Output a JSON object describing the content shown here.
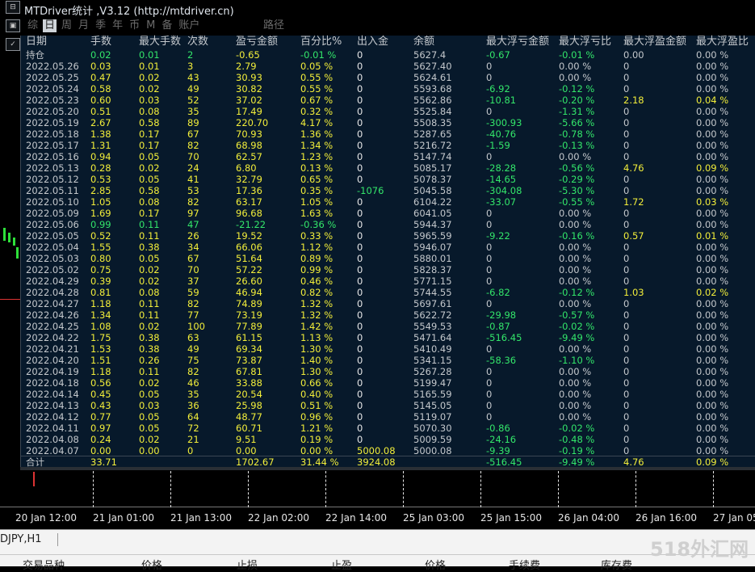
{
  "window": {
    "title": "MTDriver统计 ,V3.12 (http://mtdriver.cn)"
  },
  "tabs": [
    {
      "label": "综",
      "active": false
    },
    {
      "label": "日",
      "active": true
    },
    {
      "label": "周",
      "active": false
    },
    {
      "label": "月",
      "active": false
    },
    {
      "label": "季",
      "active": false
    },
    {
      "label": "年",
      "active": false
    },
    {
      "label": "币",
      "active": false
    },
    {
      "label": "M",
      "active": false
    },
    {
      "label": "备",
      "active": false
    },
    {
      "label": "账户",
      "active": false
    }
  ],
  "path_tab": "路径",
  "left_icons": [
    "⊟",
    "✓"
  ],
  "table": {
    "headers": [
      "日期",
      "手数",
      "最大手数",
      "次数",
      "盈亏金额",
      "百分比%",
      "出入金",
      "余额",
      "最大浮亏金额",
      "最大浮亏比",
      "最大浮盈金额",
      "最大浮盈比"
    ],
    "holding": {
      "date": "持仓",
      "lots": "0.02",
      "maxlots": "0.01",
      "count": "2",
      "pnl": "-0.65",
      "pct": "-0.01 %",
      "flow": "0",
      "balance": "5627.4",
      "floss": "-0.67",
      "flossp": "-0.01 %",
      "fgain": "0.00",
      "fgainp": "0.00 %"
    },
    "rows": [
      [
        "2022.05.26",
        "0.03",
        "0.01",
        "3",
        "2.79",
        "0.05 %",
        "0",
        "5627.40",
        "0",
        "0.00 %",
        "0",
        "0.00 %"
      ],
      [
        "2022.05.25",
        "0.47",
        "0.02",
        "43",
        "30.93",
        "0.55 %",
        "0",
        "5624.61",
        "0",
        "0.00 %",
        "0",
        "0.00 %"
      ],
      [
        "2022.05.24",
        "0.58",
        "0.02",
        "49",
        "30.82",
        "0.55 %",
        "0",
        "5593.68",
        "-6.92",
        "-0.12 %",
        "0",
        "0.00 %"
      ],
      [
        "2022.05.23",
        "0.60",
        "0.03",
        "52",
        "37.02",
        "0.67 %",
        "0",
        "5562.86",
        "-10.81",
        "-0.20 %",
        "2.18",
        "0.04 %"
      ],
      [
        "2022.05.20",
        "0.51",
        "0.08",
        "35",
        "17.49",
        "0.32 %",
        "0",
        "5525.84",
        "0",
        "-1.31 %",
        "0",
        "0.00 %"
      ],
      [
        "2022.05.19",
        "2.67",
        "0.58",
        "89",
        "220.70",
        "4.17 %",
        "0",
        "5508.35",
        "-300.93",
        "-5.66 %",
        "0",
        "0.00 %"
      ],
      [
        "2022.05.18",
        "1.38",
        "0.17",
        "67",
        "70.93",
        "1.36 %",
        "0",
        "5287.65",
        "-40.76",
        "-0.78 %",
        "0",
        "0.00 %"
      ],
      [
        "2022.05.17",
        "1.31",
        "0.17",
        "82",
        "68.98",
        "1.34 %",
        "0",
        "5216.72",
        "-1.59",
        "-0.13 %",
        "0",
        "0.00 %"
      ],
      [
        "2022.05.16",
        "0.94",
        "0.05",
        "70",
        "62.57",
        "1.23 %",
        "0",
        "5147.74",
        "0",
        "0.00 %",
        "0",
        "0.00 %"
      ],
      [
        "2022.05.13",
        "0.28",
        "0.02",
        "24",
        "6.80",
        "0.13 %",
        "0",
        "5085.17",
        "-28.28",
        "-0.56 %",
        "4.76",
        "0.09 %"
      ],
      [
        "2022.05.12",
        "0.53",
        "0.05",
        "41",
        "32.79",
        "0.65 %",
        "0",
        "5078.37",
        "-14.65",
        "-0.29 %",
        "0",
        "0.00 %"
      ],
      [
        "2022.05.11",
        "2.85",
        "0.58",
        "53",
        "17.36",
        "0.35 %",
        "-1076",
        "5045.58",
        "-304.08",
        "-5.30 %",
        "0",
        "0.00 %"
      ],
      [
        "2022.05.10",
        "1.05",
        "0.08",
        "82",
        "63.17",
        "1.05 %",
        "0",
        "6104.22",
        "-33.07",
        "-0.55 %",
        "1.72",
        "0.03 %"
      ],
      [
        "2022.05.09",
        "1.69",
        "0.17",
        "97",
        "96.68",
        "1.63 %",
        "0",
        "6041.05",
        "0",
        "0.00 %",
        "0",
        "0.00 %"
      ],
      [
        "2022.05.06",
        "0.99",
        "0.11",
        "47",
        "-21.22",
        "-0.36 %",
        "0",
        "5944.37",
        "0",
        "0.00 %",
        "0",
        "0.00 %"
      ],
      [
        "2022.05.05",
        "0.52",
        "0.11",
        "26",
        "19.52",
        "0.33 %",
        "0",
        "5965.59",
        "-9.22",
        "-0.16 %",
        "0.57",
        "0.01 %"
      ],
      [
        "2022.05.04",
        "1.55",
        "0.38",
        "34",
        "66.06",
        "1.12 %",
        "0",
        "5946.07",
        "0",
        "0.00 %",
        "0",
        "0.00 %"
      ],
      [
        "2022.05.03",
        "0.80",
        "0.05",
        "67",
        "51.64",
        "0.89 %",
        "0",
        "5880.01",
        "0",
        "0.00 %",
        "0",
        "0.00 %"
      ],
      [
        "2022.05.02",
        "0.75",
        "0.02",
        "70",
        "57.22",
        "0.99 %",
        "0",
        "5828.37",
        "0",
        "0.00 %",
        "0",
        "0.00 %"
      ],
      [
        "2022.04.29",
        "0.39",
        "0.02",
        "37",
        "26.60",
        "0.46 %",
        "0",
        "5771.15",
        "0",
        "0.00 %",
        "0",
        "0.00 %"
      ],
      [
        "2022.04.28",
        "0.81",
        "0.08",
        "59",
        "46.94",
        "0.82 %",
        "0",
        "5744.55",
        "-6.82",
        "-0.12 %",
        "1.03",
        "0.02 %"
      ],
      [
        "2022.04.27",
        "1.18",
        "0.11",
        "82",
        "74.89",
        "1.32 %",
        "0",
        "5697.61",
        "0",
        "0.00 %",
        "0",
        "0.00 %"
      ],
      [
        "2022.04.26",
        "1.34",
        "0.11",
        "77",
        "73.19",
        "1.32 %",
        "0",
        "5622.72",
        "-29.98",
        "-0.57 %",
        "0",
        "0.00 %"
      ],
      [
        "2022.04.25",
        "1.08",
        "0.02",
        "100",
        "77.89",
        "1.42 %",
        "0",
        "5549.53",
        "-0.87",
        "-0.02 %",
        "0",
        "0.00 %"
      ],
      [
        "2022.04.22",
        "1.75",
        "0.38",
        "63",
        "61.15",
        "1.13 %",
        "0",
        "5471.64",
        "-516.45",
        "-9.49 %",
        "0",
        "0.00 %"
      ],
      [
        "2022.04.21",
        "1.53",
        "0.38",
        "49",
        "69.34",
        "1.30 %",
        "0",
        "5410.49",
        "0",
        "0.00 %",
        "0",
        "0.00 %"
      ],
      [
        "2022.04.20",
        "1.51",
        "0.26",
        "75",
        "73.87",
        "1.40 %",
        "0",
        "5341.15",
        "-58.36",
        "-1.10 %",
        "0",
        "0.00 %"
      ],
      [
        "2022.04.19",
        "1.18",
        "0.11",
        "82",
        "67.81",
        "1.30 %",
        "0",
        "5267.28",
        "0",
        "0.00 %",
        "0",
        "0.00 %"
      ],
      [
        "2022.04.18",
        "0.56",
        "0.02",
        "46",
        "33.88",
        "0.66 %",
        "0",
        "5199.47",
        "0",
        "0.00 %",
        "0",
        "0.00 %"
      ],
      [
        "2022.04.14",
        "0.45",
        "0.05",
        "35",
        "20.54",
        "0.40 %",
        "0",
        "5165.59",
        "0",
        "0.00 %",
        "0",
        "0.00 %"
      ],
      [
        "2022.04.13",
        "0.43",
        "0.03",
        "36",
        "25.98",
        "0.51 %",
        "0",
        "5145.05",
        "0",
        "0.00 %",
        "0",
        "0.00 %"
      ],
      [
        "2022.04.12",
        "0.77",
        "0.05",
        "64",
        "48.77",
        "0.96 %",
        "0",
        "5119.07",
        "0",
        "0.00 %",
        "0",
        "0.00 %"
      ],
      [
        "2022.04.11",
        "0.97",
        "0.05",
        "72",
        "60.71",
        "1.21 %",
        "0",
        "5070.30",
        "-0.86",
        "-0.02 %",
        "0",
        "0.00 %"
      ],
      [
        "2022.04.08",
        "0.24",
        "0.02",
        "21",
        "9.51",
        "0.19 %",
        "0",
        "5009.59",
        "-24.16",
        "-0.48 %",
        "0",
        "0.00 %"
      ],
      [
        "2022.04.07",
        "0.00",
        "0.00",
        "0",
        "0.00",
        "0.00 %",
        "5000.08",
        "5000.08",
        "-9.39",
        "-0.19 %",
        "0",
        "0.00 %"
      ]
    ],
    "totals": {
      "date": "合计",
      "lots": "33.71",
      "pnl": "1702.67",
      "pct": "31.44 %",
      "flow": "3924.08",
      "floss": "-516.45",
      "flossp": "-9.49 %",
      "fgain": "4.76",
      "fgainp": "0.09 %"
    }
  },
  "time_axis": [
    "20 Jan 12:00",
    "21 Jan 01:00",
    "21 Jan 13:00",
    "22 Jan 02:00",
    "22 Jan 14:00",
    "25 Jan 03:00",
    "25 Jan 15:00",
    "26 Jan 04:00",
    "26 Jan 16:00",
    "27 Jan 05"
  ],
  "bottom": {
    "symbol_tab": "DJPY,H1",
    "columns": [
      "交易品种",
      "价格",
      "止损",
      "止盈",
      "价格",
      "手续费",
      "库存费"
    ]
  },
  "watermark": "518外汇网",
  "colors": {
    "panel_bg": "#07192b",
    "green": "#33e66a",
    "yellow": "#f2ee3a",
    "gray": "#c4c8cc",
    "white": "#e8e8e8"
  }
}
